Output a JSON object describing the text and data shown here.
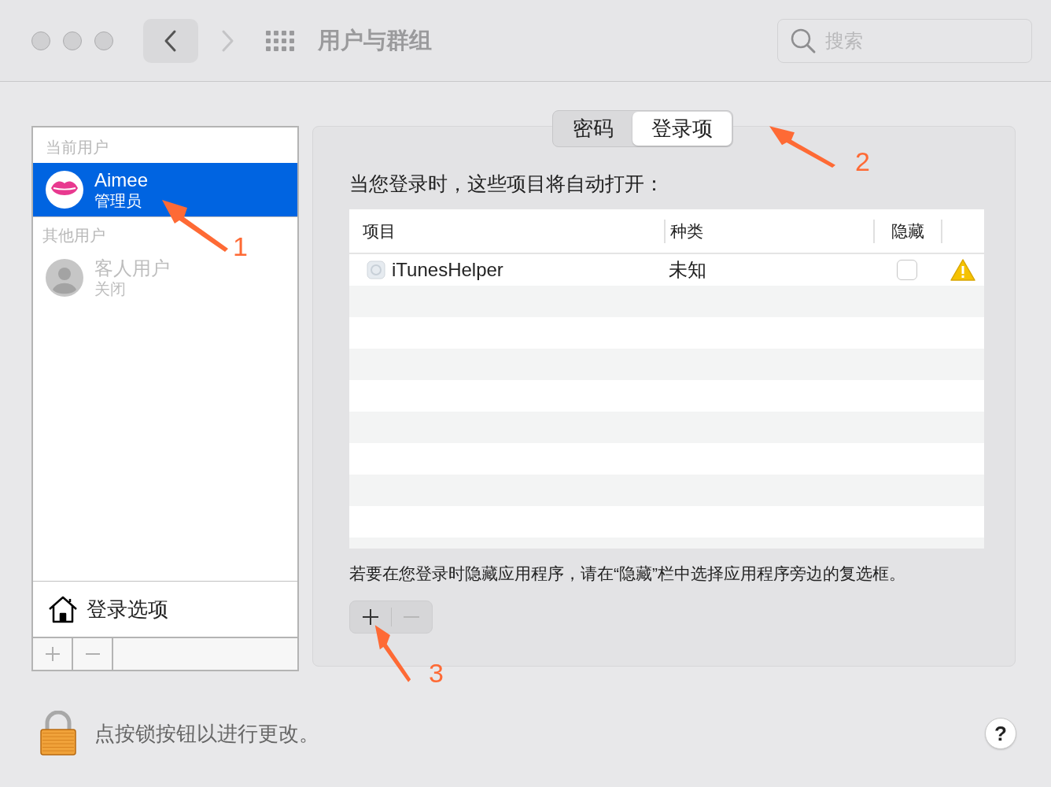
{
  "window": {
    "title": "用户与群组",
    "search": {
      "placeholder": "搜索"
    }
  },
  "sidebar": {
    "sections": [
      {
        "header": "当前用户",
        "users": [
          {
            "name": "Aimee",
            "role": "管理员",
            "selected": true,
            "disabled": false,
            "kind": "photo"
          }
        ]
      },
      {
        "header": "其他用户",
        "users": [
          {
            "name": "客人用户",
            "role": "关闭",
            "selected": false,
            "disabled": true,
            "kind": "guest"
          }
        ]
      }
    ],
    "login_options": "登录选项"
  },
  "tabs": [
    {
      "label": "密码",
      "selected": false
    },
    {
      "label": "登录项",
      "selected": true
    }
  ],
  "intro": "当您登录时，这些项目将自动打开：",
  "table": {
    "columns": [
      "项目",
      "种类",
      "隐藏"
    ],
    "rows": [
      {
        "item": "iTunesHelper",
        "type": "未知",
        "hidden": false,
        "warning": true
      }
    ]
  },
  "hint": "若要在您登录时隐藏应用程序，请在“隐藏”栏中选择应用程序旁边的复选框。",
  "lock_message": "点按锁按钮以进行更改。",
  "help": "?",
  "annotations": [
    {
      "label": "1"
    },
    {
      "label": "2"
    },
    {
      "label": "3"
    }
  ]
}
